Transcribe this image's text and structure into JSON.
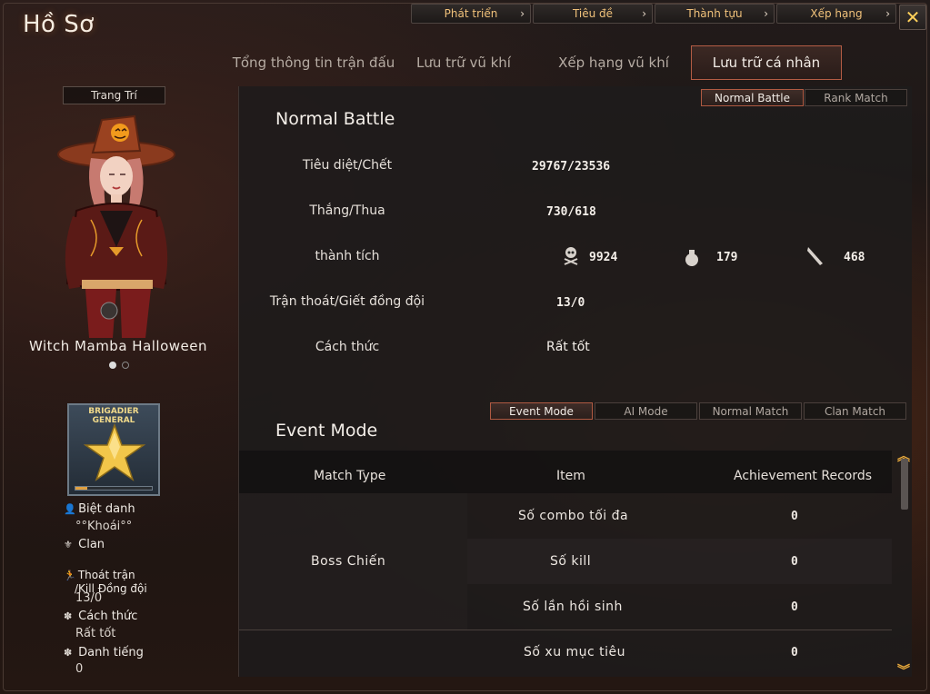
{
  "window": {
    "title": "Hồ Sơ"
  },
  "top_menu": [
    {
      "label": "Phát triển"
    },
    {
      "label": "Tiêu đề"
    },
    {
      "label": "Thành tựu"
    },
    {
      "label": "Xếp hạng"
    }
  ],
  "close_icon": "close-icon",
  "tabs": [
    {
      "label": "Tổng thông tin trận đấu",
      "active": false
    },
    {
      "label": "Lưu trữ vũ khí",
      "active": false
    },
    {
      "label": "Xếp hạng vũ khí",
      "active": false
    },
    {
      "label": "Lưu trữ cá nhân",
      "active": true
    }
  ],
  "left": {
    "decoration_label": "Trang Trí",
    "character_name": "Witch Mamba Halloween",
    "carousel": {
      "current": 1,
      "total": 2
    },
    "rank": {
      "line1": "BRIGADIER",
      "line2": "GENERAL",
      "progress": 0.15
    },
    "nickname_label": "Biệt danh",
    "nickname_value": "°°Khoái°°",
    "clan_label": "Clan",
    "escape_label_1": "Thoát trận",
    "escape_label_2": "/Kill Đồng đội",
    "escape_value": "13/0",
    "style_label": "Cách thức",
    "style_value": "Rất tốt",
    "reputation_label": "Danh tiếng",
    "reputation_value": "0"
  },
  "mode_tabs": [
    {
      "label": "Normal Battle",
      "active": true
    },
    {
      "label": "Rank Match",
      "active": false
    }
  ],
  "normal_battle": {
    "title": "Normal Battle",
    "rows": {
      "kd_label": "Tiêu diệt/Chết",
      "kd_value": "29767/23536",
      "wl_label": "Thắng/Thua",
      "wl_value": "730/618",
      "ach_label": "thành tích",
      "ach_skull": "9924",
      "ach_grenade": "179",
      "ach_knife": "468",
      "escape_label": "Trận thoát/Giết đồng đội",
      "escape_value": "13/0",
      "style_label": "Cách thức",
      "style_value": "Rất tốt"
    }
  },
  "event_tabs": [
    {
      "label": "Event Mode",
      "active": true
    },
    {
      "label": "AI Mode",
      "active": false
    },
    {
      "label": "Normal Match",
      "active": false
    },
    {
      "label": "Clan Match",
      "active": false
    }
  ],
  "event_mode": {
    "title": "Event Mode",
    "headers": {
      "match_type": "Match Type",
      "item": "Item",
      "records": "Achievement Records"
    },
    "match_type": "Boss Chiến",
    "rows": [
      {
        "item": "Số combo tối đa",
        "value": "0"
      },
      {
        "item": "Số kill",
        "value": "0"
      },
      {
        "item": "Số lần hồi sinh",
        "value": "0"
      },
      {
        "item": "Số xu mục tiêu",
        "value": "0"
      }
    ]
  },
  "colors": {
    "accent": "#b45c44",
    "gold": "#f0c17a",
    "close": "#ffd05a"
  }
}
